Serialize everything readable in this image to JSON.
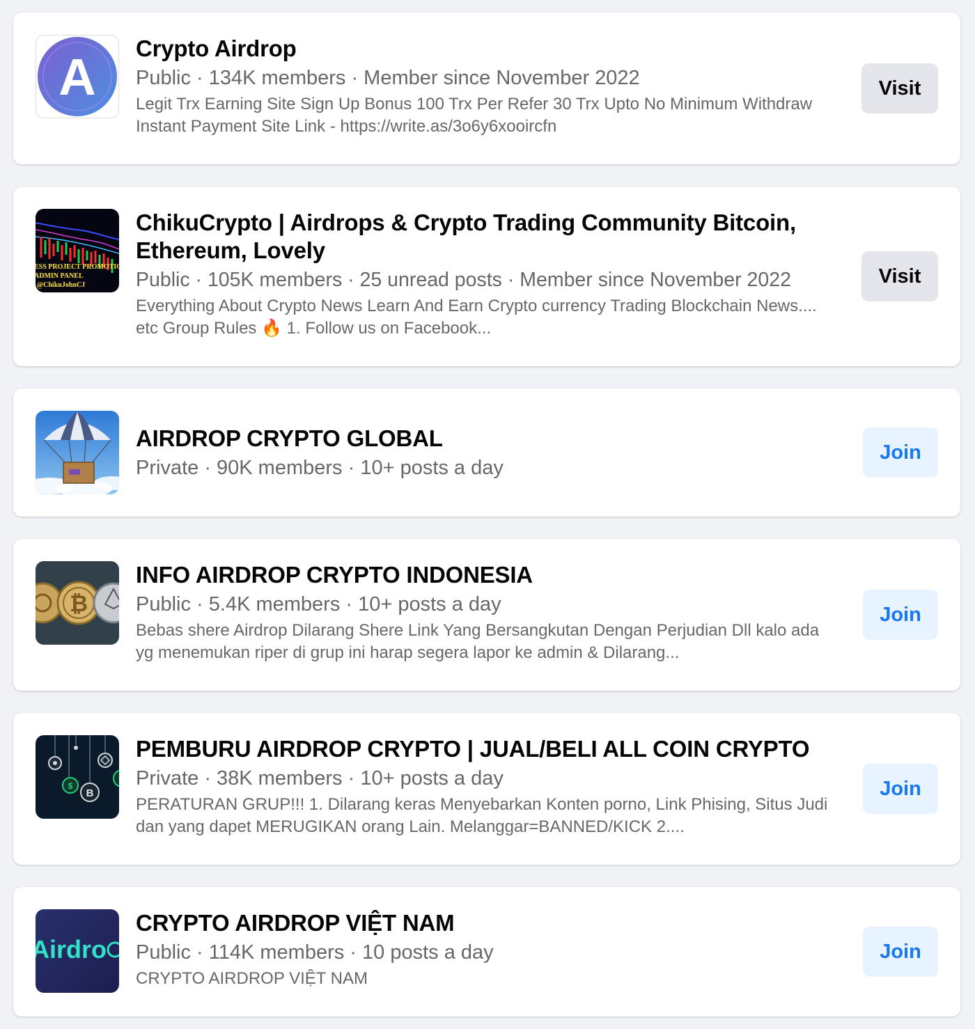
{
  "groups": [
    {
      "name": "Crypto Airdrop",
      "meta": "Public · 134K members · Member since November 2022",
      "description": "Legit Trx Earning Site Sign Up Bonus 100 Trx Per Refer 30 Trx Upto No Minimum Withdraw Instant Payment Site Link - https://write.as/3o6y6xooircfn",
      "button": "Visit",
      "thumb": {
        "icon": "letter-a-logo",
        "letter": "A",
        "color": "#6a6fd6"
      }
    },
    {
      "name": "ChikuCrypto | Airdrops & Crypto Trading Community Bitcoin, Ethereum, Lovely",
      "meta": "Public · 105K members · 25 unread posts · Member since November 2022",
      "description": "Everything About Crypto News Learn And Earn Crypto currency Trading Blockchain News.... etc Group Rules 🔥 1. Follow us on Facebook...",
      "button": "Visit",
      "thumb": {
        "icon": "trading-chart-image",
        "line1": "ESS PROJECT PROMOTIO",
        "line2": "ADMIN PANEL",
        "line3": "- @ChikuJohnCJ"
      }
    },
    {
      "name": "AIRDROP CRYPTO GLOBAL",
      "meta": "Private · 90K members · 10+ posts a day",
      "description": "",
      "button": "Join",
      "thumb": {
        "icon": "parachute-box-image"
      }
    },
    {
      "name": "INFO AIRDROP CRYPTO INDONESIA",
      "meta": "Public · 5.4K members · 10+ posts a day",
      "description": "Bebas shere Airdrop Dilarang Shere Link Yang Bersangkutan Dengan Perjudian Dll kalo ada yg menemukan riper di grup ini harap segera lapor ke admin & Dilarang...",
      "button": "Join",
      "thumb": {
        "icon": "crypto-coins-image"
      }
    },
    {
      "name": "PEMBURU AIRDROP CRYPTO | JUAL/BELI ALL COIN CRYPTO",
      "meta": "Private · 38K members · 10+ posts a day",
      "description": "PERATURAN GRUP!!! 1. Dilarang keras Menyebarkan Konten porno, Link Phising, Situs Judi dan yang dapet MERUGIKAN orang Lain. Melanggar=BANNED/KICK 2....",
      "button": "Join",
      "thumb": {
        "icon": "hanging-coins-image"
      }
    },
    {
      "name": "CRYPTO AIRDROP VIỆT NAM",
      "meta": "Public · 114K members · 10 posts a day",
      "description": "CRYPTO AIRDROP VIỆT NAM",
      "button": "Join",
      "thumb": {
        "icon": "airdrop-wordmark-image",
        "text": "Airdro"
      }
    }
  ]
}
